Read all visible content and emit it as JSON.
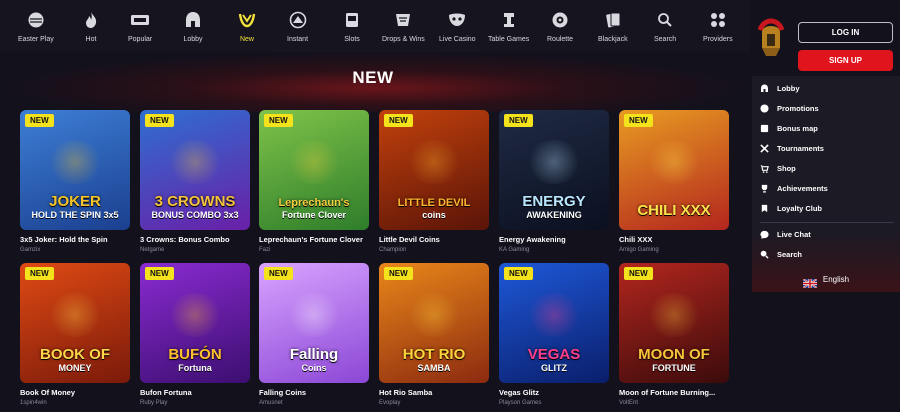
{
  "nav": {
    "items": [
      {
        "label": "Easter Play",
        "icon": "egg-icon"
      },
      {
        "label": "Hot",
        "icon": "flame-icon"
      },
      {
        "label": "Popular",
        "icon": "ticket-icon"
      },
      {
        "label": "Lobby",
        "icon": "helmet-icon"
      },
      {
        "label": "New",
        "icon": "new-icon"
      },
      {
        "label": "Instant",
        "icon": "instant-icon"
      },
      {
        "label": "Slots",
        "icon": "slots-icon"
      },
      {
        "label": "Drops & Wins",
        "icon": "drops-icon"
      },
      {
        "label": "Live Casino",
        "icon": "mask-icon"
      },
      {
        "label": "Table Games",
        "icon": "table-icon"
      },
      {
        "label": "Roulette",
        "icon": "roulette-icon"
      },
      {
        "label": "Blackjack",
        "icon": "cards-icon"
      },
      {
        "label": "Search",
        "icon": "search-icon"
      },
      {
        "label": "Providers",
        "icon": "grid-icon"
      }
    ],
    "active": "New",
    "active_color": "#f2e23a"
  },
  "page": {
    "title": "NEW"
  },
  "badge_label": "NEW",
  "games": [
    {
      "name": "3x5 Joker: Hold the Spin",
      "provider": "Gamzix",
      "art": "JOKER",
      "art2": "HOLD THE SPIN 3x5",
      "bg": [
        "#3d7fd6",
        "#1b3f8f"
      ],
      "art_color": "#f7c52a"
    },
    {
      "name": "3 Crowns: Bonus Combo",
      "provider": "Netgame",
      "art": "3 CROWNS",
      "art2": "BONUS COMBO 3x3",
      "bg": [
        "#2e6fd0",
        "#6a1fa8"
      ],
      "art_color": "#f5c23b"
    },
    {
      "name": "Leprechaun's Fortune Clover",
      "provider": "Fazi",
      "art": "Leprechaun's",
      "art2": "Fortune Clover",
      "bg": [
        "#7fc34a",
        "#2e7d2a"
      ],
      "art_color": "#f4d03f"
    },
    {
      "name": "Little Devil Coins",
      "provider": "Champion",
      "art": "LITTLE DEVIL",
      "art2": "coins",
      "bg": [
        "#c2410c",
        "#5a1408"
      ],
      "art_color": "#ffb52e"
    },
    {
      "name": "Energy Awakening",
      "provider": "KA Gaming",
      "art": "ENERGY",
      "art2": "AWAKENING",
      "bg": [
        "#1f2a44",
        "#0b1020"
      ],
      "art_color": "#b9e6ff"
    },
    {
      "name": "Chili XXX",
      "provider": "Amigo Gaming",
      "art": "CHILI XXX",
      "art2": "",
      "bg": [
        "#e89b22",
        "#b3261e"
      ],
      "art_color": "#ffe14a"
    },
    {
      "name": "Book Of Money",
      "provider": "1spin4win",
      "art": "BOOK OF",
      "art2": "MONEY",
      "bg": [
        "#e04a14",
        "#7a1a0a"
      ],
      "art_color": "#ffd54a"
    },
    {
      "name": "Bufon Fortuna",
      "provider": "Ruby Play",
      "art": "BUFÓN",
      "art2": "Fortuna",
      "bg": [
        "#8a2bd1",
        "#3c0e70"
      ],
      "art_color": "#ffc02e"
    },
    {
      "name": "Falling Coins",
      "provider": "Amusnet",
      "art": "Falling",
      "art2": "Coins",
      "bg": [
        "#d9a3ff",
        "#8b47d6"
      ],
      "art_color": "#ffffff"
    },
    {
      "name": "Hot Rio Samba",
      "provider": "Evoplay",
      "art": "HOT RIO",
      "art2": "SAMBA",
      "bg": [
        "#e9871a",
        "#8c2a10"
      ],
      "art_color": "#ffd43b"
    },
    {
      "name": "Vegas Glitz",
      "provider": "Playson Games",
      "art": "VEGAS",
      "art2": "GLITZ",
      "bg": [
        "#1e58d8",
        "#0a1e6b"
      ],
      "art_color": "#ff3f8e"
    },
    {
      "name": "Moon of Fortune Burning...",
      "provider": "VoltEnt",
      "art": "MOON OF",
      "art2": "FORTUNE",
      "bg": [
        "#b3261e",
        "#3b0b0b"
      ],
      "art_color": "#f8c53a"
    }
  ],
  "auth": {
    "login": "LOG IN",
    "signup": "SIGN UP",
    "signup_color": "#e0141d"
  },
  "menu": {
    "items": [
      {
        "label": "Lobby",
        "icon": "helmet-icon"
      },
      {
        "label": "Promotions",
        "icon": "promo-icon"
      },
      {
        "label": "Bonus map",
        "icon": "map-icon"
      },
      {
        "label": "Tournaments",
        "icon": "swords-icon"
      },
      {
        "label": "Shop",
        "icon": "shop-icon"
      },
      {
        "label": "Achievements",
        "icon": "trophy-icon"
      },
      {
        "label": "Loyalty Club",
        "icon": "loyalty-icon"
      }
    ],
    "secondary": [
      {
        "label": "Live Chat",
        "icon": "chat-icon"
      },
      {
        "label": "Search",
        "icon": "search-icon"
      }
    ]
  },
  "language": {
    "label": "English",
    "flag": "uk-flag-icon"
  }
}
